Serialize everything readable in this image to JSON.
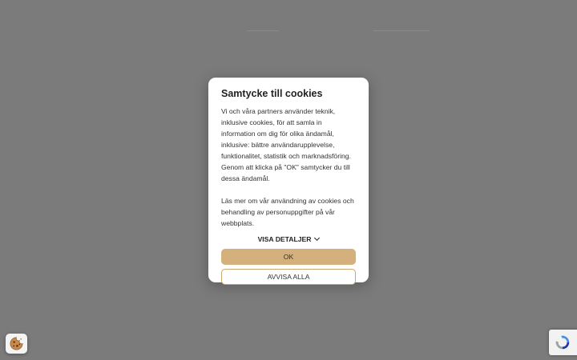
{
  "consent_dialog": {
    "title": "Samtycke till cookies",
    "body": "Vi och våra partners använder teknik, inklusive cookies, för att samla in information om dig för olika ändamål, inklusive: bättre användarupplevelse, funktionalitet, statistik och marknadsföring. Genom att klicka på \"OK\" samtycker du till dessa ändamål.\n\nLäs mer om vår användning av cookies och behandling av personuppgifter på vår webbplats.",
    "details_label": "VISA DETALJER",
    "ok_label": "OK",
    "reject_label": "AVVISA ALLA"
  },
  "widgets": {
    "cookie_settings_icon": "cookie-icon",
    "recaptcha_icon": "recaptcha-icon"
  },
  "colors": {
    "overlay": "#7b7b7b",
    "accent": "#d4b07c",
    "accent_border": "#c9a66d"
  }
}
